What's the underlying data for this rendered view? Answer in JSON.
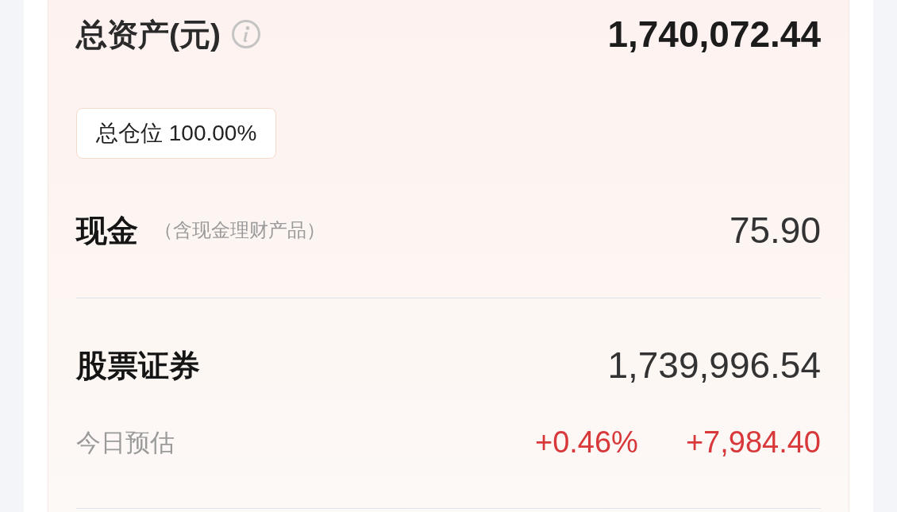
{
  "summary": {
    "title": "总资产(元)",
    "value": "1,740,072.44"
  },
  "position_tag": {
    "text": "总仓位 100.00%"
  },
  "rows": [
    {
      "kind": "cash",
      "label": "现金",
      "note": "（含现金理财产品）",
      "value": "75.90"
    },
    {
      "kind": "stocks",
      "label": "股票证券",
      "value": "1,739,996.54"
    }
  ],
  "today_estimate": {
    "label": "今日预估",
    "change_percent": "+0.46%",
    "change_amount": "+7,984.40"
  }
}
